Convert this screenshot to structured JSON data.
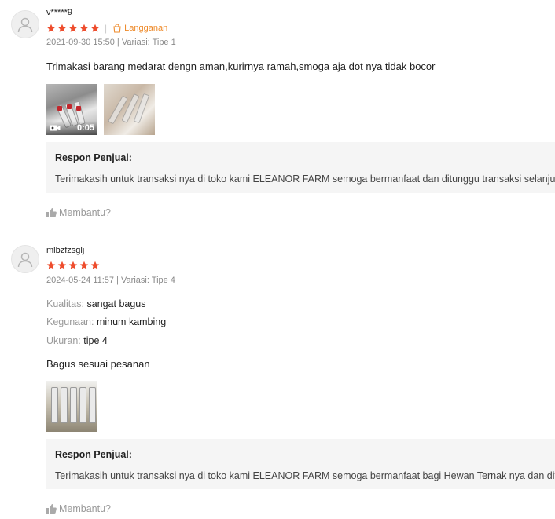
{
  "reviews": [
    {
      "username": "v*****9",
      "rating": 5,
      "badge": "Langganan",
      "date": "2021-09-30 15:50",
      "variant": "Variasi: Tipe 1",
      "comment": "Trimakasi barang medarat dengn aman,kurirnya ramah,smoga aja dot nya tidak bocor",
      "video_duration": "0:05",
      "reply_title": "Respon Penjual:",
      "reply_text": "Terimakasih untuk transaksi nya di toko kami ELEANOR FARM semoga bermanfaat dan ditunggu transaksi selanjutnya",
      "helpful": "Membantu?"
    },
    {
      "username": "mlbzfzsglj",
      "rating": 5,
      "date": "2024-05-24 11:57",
      "variant": "Variasi: Tipe 4",
      "attributes": [
        {
          "key": "Kualitas:",
          "value": "sangat bagus"
        },
        {
          "key": "Kegunaan:",
          "value": "minum kambing"
        },
        {
          "key": "Ukuran:",
          "value": "tipe 4"
        }
      ],
      "comment": "Bagus sesuai pesanan",
      "reply_title": "Respon Penjual:",
      "reply_text": "Terimakasih untuk transaksi nya di toko kami ELEANOR FARM semoga bermanfaat bagi Hewan Ternak nya dan ditunggu transaksi selanjutnya",
      "helpful": "Membantu?"
    }
  ],
  "colors": {
    "star": "#ee4d2d",
    "badge": "#ee8a2a"
  },
  "icons": {
    "avatar": "user-avatar-icon",
    "star": "star-icon",
    "badge": "bag-icon",
    "video": "video-camera-icon",
    "helpful": "thumbs-up-icon"
  }
}
